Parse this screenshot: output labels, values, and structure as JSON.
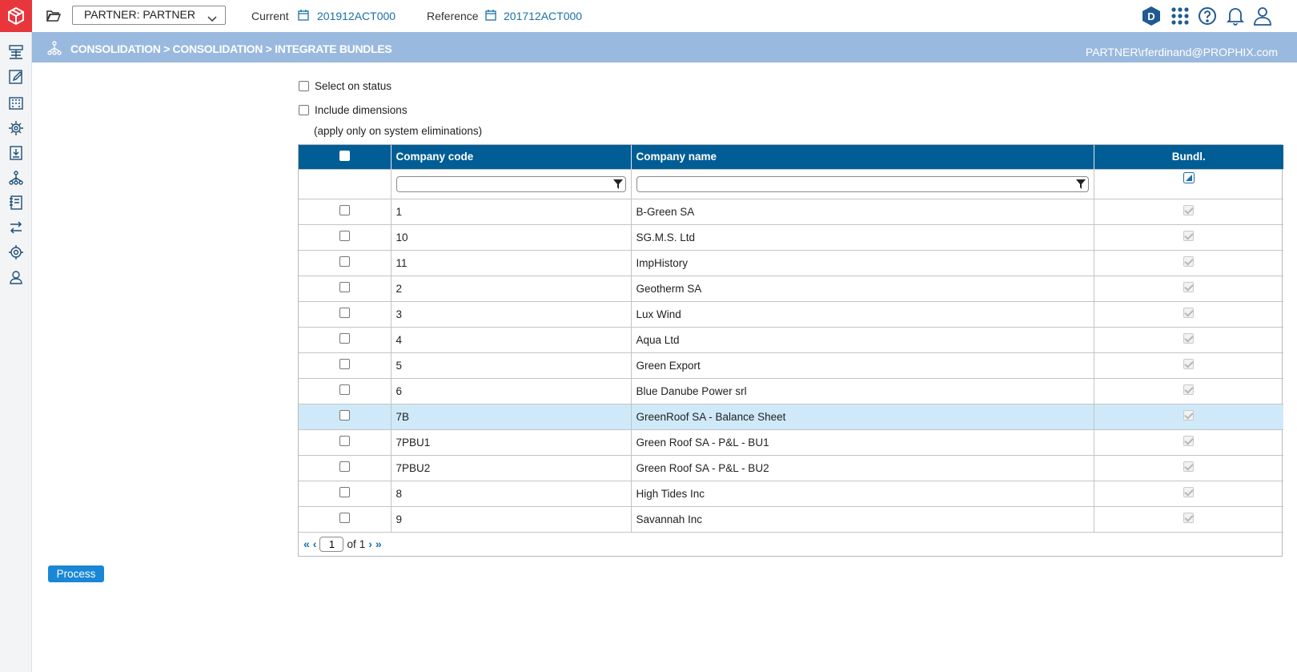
{
  "topbar": {
    "entity_select": "PARTNER: PARTNER",
    "current_label": "Current",
    "current_value": "201912ACT000",
    "reference_label": "Reference",
    "reference_value": "201712ACT000",
    "avatar_letter": "D"
  },
  "header": {
    "breadcrumb": "CONSOLIDATION > CONSOLIDATION > INTEGRATE BUNDLES",
    "user": "PARTNER\\rferdinand@PROPHIX.com"
  },
  "options": {
    "select_on_status": "Select on status",
    "include_dimensions": "Include dimensions",
    "note": "(apply only on system eliminations)"
  },
  "table": {
    "columns": [
      "Company code",
      "Company name",
      "Bundl."
    ],
    "rows": [
      {
        "code": "1",
        "name": "B-Green SA"
      },
      {
        "code": "10",
        "name": "SG.M.S. Ltd"
      },
      {
        "code": "11",
        "name": "ImpHistory"
      },
      {
        "code": "2",
        "name": "Geotherm SA"
      },
      {
        "code": "3",
        "name": "Lux Wind"
      },
      {
        "code": "4",
        "name": "Aqua Ltd"
      },
      {
        "code": "5",
        "name": "Green Export"
      },
      {
        "code": "6",
        "name": "Blue Danube Power srl"
      },
      {
        "code": "7B",
        "name": "GreenRoof SA - Balance Sheet"
      },
      {
        "code": "7PBU1",
        "name": "Green Roof SA - P&L - BU1"
      },
      {
        "code": "7PBU2",
        "name": "Green Roof SA - P&L - BU2"
      },
      {
        "code": "8",
        "name": "High Tides Inc"
      },
      {
        "code": "9",
        "name": "Savannah Inc"
      }
    ],
    "selected_row": 8
  },
  "pager": {
    "page": "1",
    "of_label": "of",
    "total": "1"
  },
  "actions": {
    "process": "Process"
  },
  "colors": {
    "brand": "#e8363d",
    "header_band": "#9ab9de",
    "table_header": "#005d96",
    "accent": "#1b6fa8",
    "selected_row": "#cfe9f9",
    "button": "#1a87d6"
  }
}
